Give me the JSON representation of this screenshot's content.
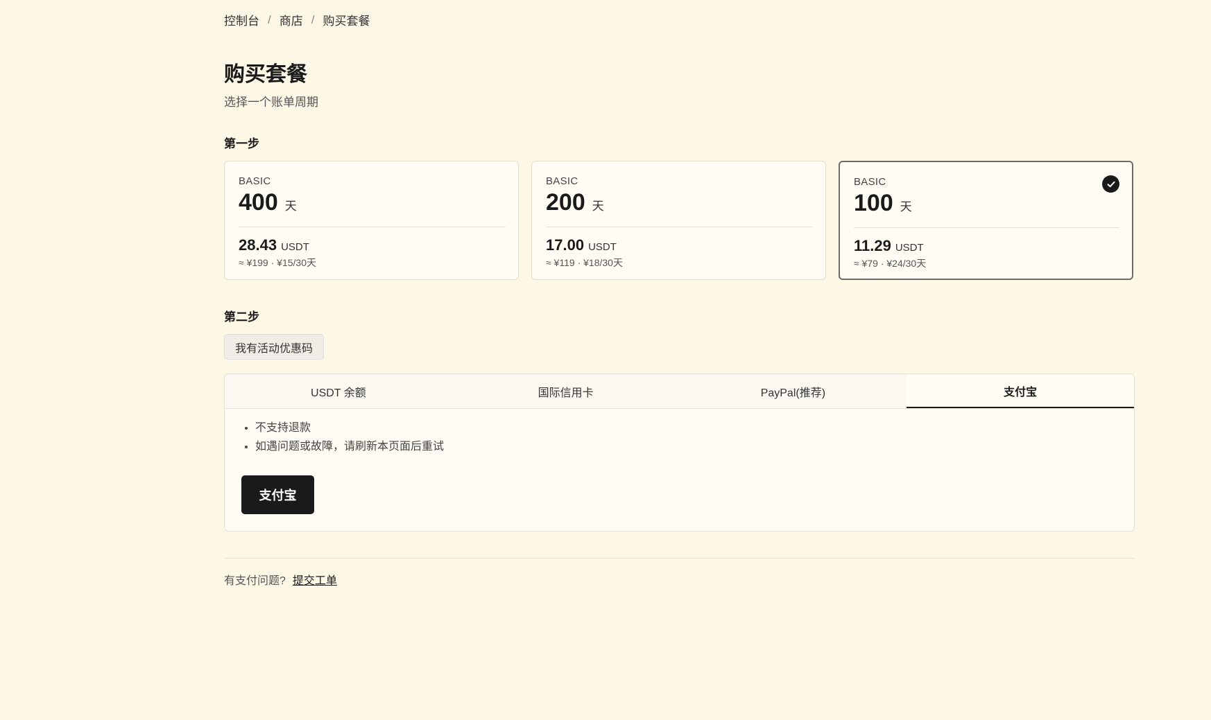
{
  "breadcrumb": {
    "items": [
      "控制台",
      "商店",
      "购买套餐"
    ],
    "separator": "/"
  },
  "header": {
    "title": "购买套餐",
    "subtitle": "选择一个账单周期"
  },
  "step1": {
    "label": "第一步",
    "plans": [
      {
        "tier": "BASIC",
        "days": "400",
        "unit": "天",
        "price": "28.43",
        "currency": "USDT",
        "approx": "≈ ¥199 · ¥15/30天",
        "selected": false
      },
      {
        "tier": "BASIC",
        "days": "200",
        "unit": "天",
        "price": "17.00",
        "currency": "USDT",
        "approx": "≈ ¥119 · ¥18/30天",
        "selected": false
      },
      {
        "tier": "BASIC",
        "days": "100",
        "unit": "天",
        "price": "11.29",
        "currency": "USDT",
        "approx": "≈ ¥79 · ¥24/30天",
        "selected": true
      }
    ]
  },
  "step2": {
    "label": "第二步",
    "coupon_label": "我有活动优惠码",
    "tabs": [
      {
        "label": "USDT 余额",
        "active": false
      },
      {
        "label": "国际信用卡",
        "active": false
      },
      {
        "label": "PayPal(推荐)",
        "active": false
      },
      {
        "label": "支付宝",
        "active": true
      }
    ],
    "notes": [
      "不支持退款",
      "如遇问题或故障，请刷新本页面后重试"
    ],
    "pay_button_label": "支付宝"
  },
  "footer": {
    "question": "有支付问题?",
    "link_label": "提交工单"
  },
  "colors": {
    "background": "#fdf7e6",
    "accent": "#1a1a1a",
    "card": "#fffcf4"
  }
}
